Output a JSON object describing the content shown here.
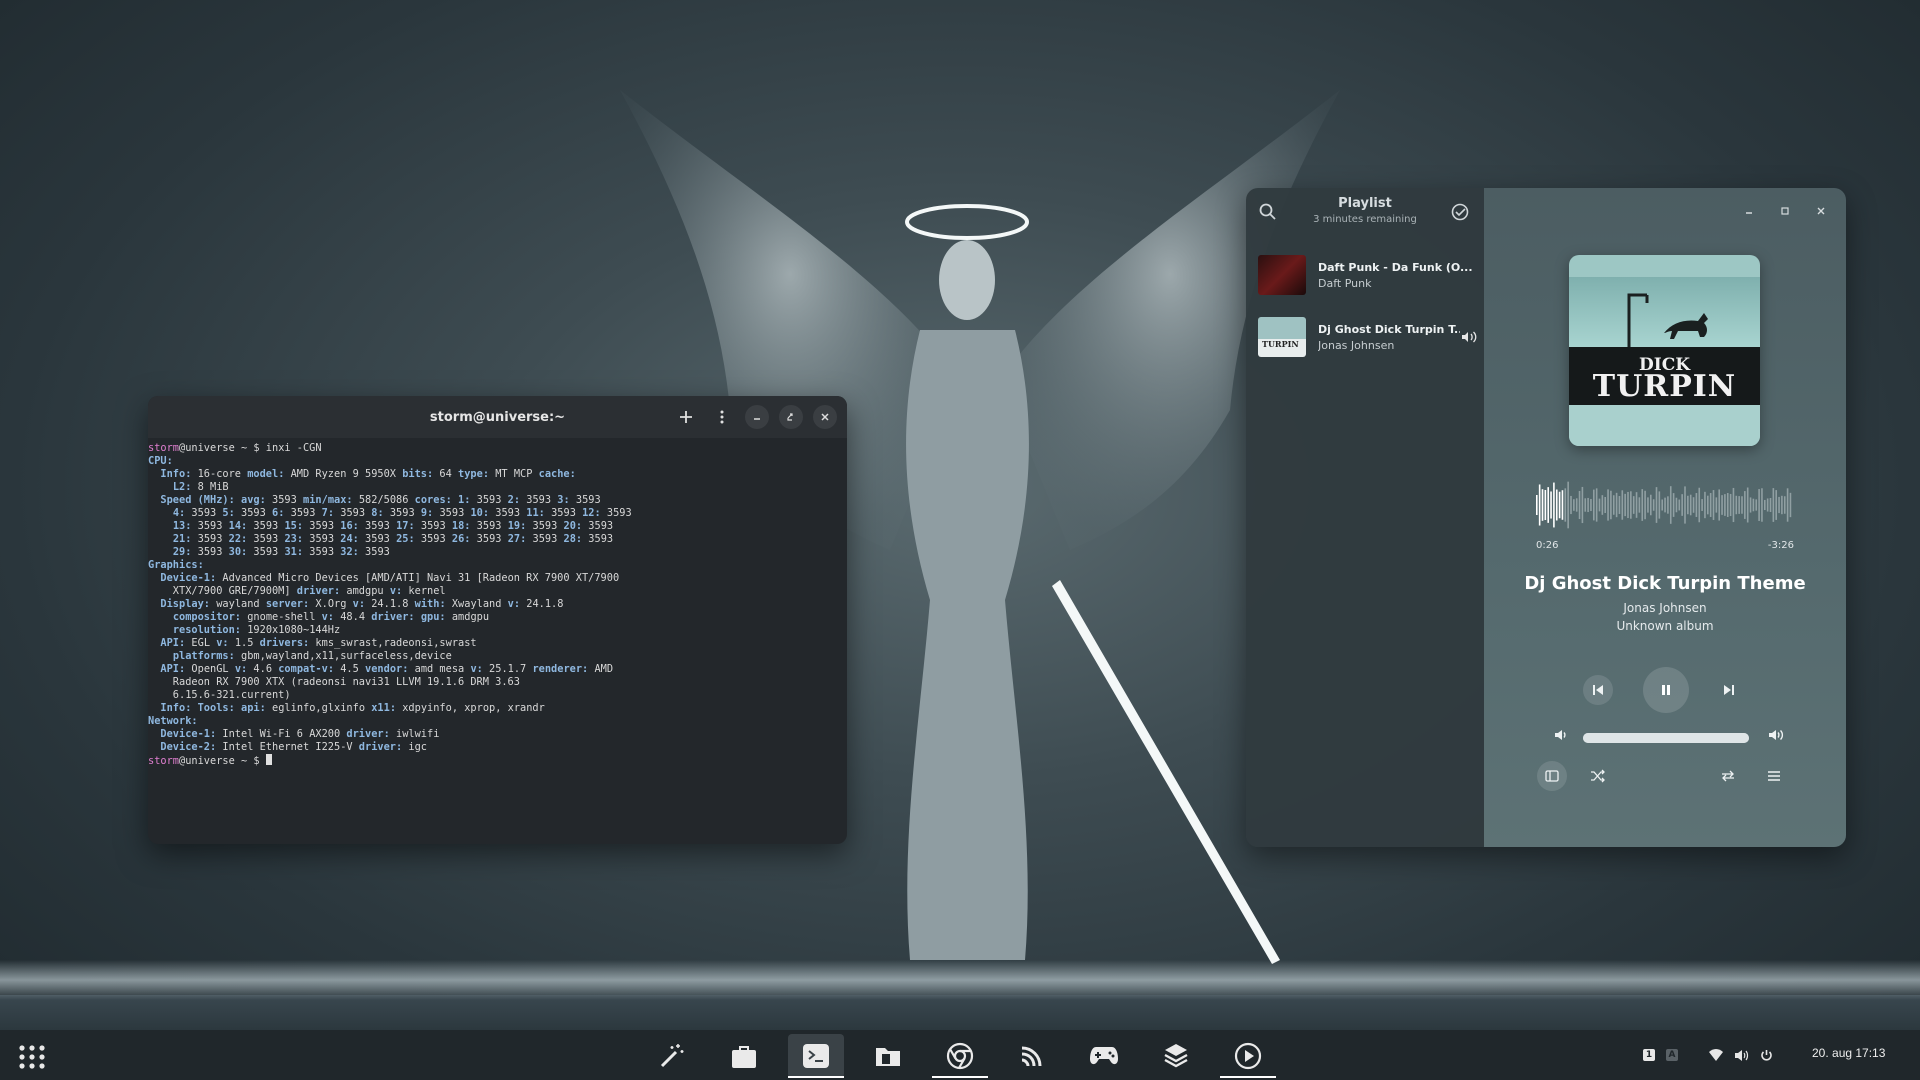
{
  "terminal": {
    "title": "storm@universe:~",
    "lines": [
      [
        [
          "pu",
          "storm"
        ],
        [
          "",
          "@universe ~ $ inxi -CGN"
        ]
      ],
      [
        [
          "sec",
          "CPU:"
        ]
      ],
      [
        [
          "",
          "  "
        ],
        [
          "kw",
          "Info:"
        ],
        [
          "",
          " 16-core "
        ],
        [
          "kw",
          "model:"
        ],
        [
          "",
          " AMD Ryzen 9 5950X "
        ],
        [
          "kw",
          "bits:"
        ],
        [
          "",
          " 64 "
        ],
        [
          "kw",
          "type:"
        ],
        [
          "",
          " MT MCP "
        ],
        [
          "kw",
          "cache:"
        ]
      ],
      [
        [
          "",
          "    "
        ],
        [
          "kw",
          "L2:"
        ],
        [
          "",
          " 8 MiB"
        ]
      ],
      [
        [
          "",
          "  "
        ],
        [
          "kw",
          "Speed (MHz):"
        ],
        [
          "",
          " "
        ],
        [
          "kw",
          "avg:"
        ],
        [
          "",
          " 3593 "
        ],
        [
          "kw",
          "min/max:"
        ],
        [
          "",
          " 582/5086 "
        ],
        [
          "kw",
          "cores:"
        ],
        [
          "",
          " "
        ],
        [
          "kw",
          "1:"
        ],
        [
          "",
          " 3593 "
        ],
        [
          "kw",
          "2:"
        ],
        [
          "",
          " 3593 "
        ],
        [
          "kw",
          "3:"
        ],
        [
          "",
          " 3593"
        ]
      ],
      [
        [
          "",
          "    "
        ],
        [
          "kw",
          "4:"
        ],
        [
          "",
          " 3593 "
        ],
        [
          "kw",
          "5:"
        ],
        [
          "",
          " 3593 "
        ],
        [
          "kw",
          "6:"
        ],
        [
          "",
          " 3593 "
        ],
        [
          "kw",
          "7:"
        ],
        [
          "",
          " 3593 "
        ],
        [
          "kw",
          "8:"
        ],
        [
          "",
          " 3593 "
        ],
        [
          "kw",
          "9:"
        ],
        [
          "",
          " 3593 "
        ],
        [
          "kw",
          "10:"
        ],
        [
          "",
          " 3593 "
        ],
        [
          "kw",
          "11:"
        ],
        [
          "",
          " 3593 "
        ],
        [
          "kw",
          "12:"
        ],
        [
          "",
          " 3593"
        ]
      ],
      [
        [
          "",
          "    "
        ],
        [
          "kw",
          "13:"
        ],
        [
          "",
          " 3593 "
        ],
        [
          "kw",
          "14:"
        ],
        [
          "",
          " 3593 "
        ],
        [
          "kw",
          "15:"
        ],
        [
          "",
          " 3593 "
        ],
        [
          "kw",
          "16:"
        ],
        [
          "",
          " 3593 "
        ],
        [
          "kw",
          "17:"
        ],
        [
          "",
          " 3593 "
        ],
        [
          "kw",
          "18:"
        ],
        [
          "",
          " 3593 "
        ],
        [
          "kw",
          "19:"
        ],
        [
          "",
          " 3593 "
        ],
        [
          "kw",
          "20:"
        ],
        [
          "",
          " 3593"
        ]
      ],
      [
        [
          "",
          "    "
        ],
        [
          "kw",
          "21:"
        ],
        [
          "",
          " 3593 "
        ],
        [
          "kw",
          "22:"
        ],
        [
          "",
          " 3593 "
        ],
        [
          "kw",
          "23:"
        ],
        [
          "",
          " 3593 "
        ],
        [
          "kw",
          "24:"
        ],
        [
          "",
          " 3593 "
        ],
        [
          "kw",
          "25:"
        ],
        [
          "",
          " 3593 "
        ],
        [
          "kw",
          "26:"
        ],
        [
          "",
          " 3593 "
        ],
        [
          "kw",
          "27:"
        ],
        [
          "",
          " 3593 "
        ],
        [
          "kw",
          "28:"
        ],
        [
          "",
          " 3593"
        ]
      ],
      [
        [
          "",
          "    "
        ],
        [
          "kw",
          "29:"
        ],
        [
          "",
          " 3593 "
        ],
        [
          "kw",
          "30:"
        ],
        [
          "",
          " 3593 "
        ],
        [
          "kw",
          "31:"
        ],
        [
          "",
          " 3593 "
        ],
        [
          "kw",
          "32:"
        ],
        [
          "",
          " 3593"
        ]
      ],
      [
        [
          "sec",
          "Graphics:"
        ]
      ],
      [
        [
          "",
          "  "
        ],
        [
          "kw",
          "Device-1:"
        ],
        [
          "",
          " Advanced Micro Devices [AMD/ATI] Navi 31 [Radeon RX 7900 XT/7900"
        ]
      ],
      [
        [
          "",
          "    XTX/7900 GRE/7900M] "
        ],
        [
          "kw",
          "driver:"
        ],
        [
          "",
          " amdgpu "
        ],
        [
          "kw",
          "v:"
        ],
        [
          "",
          " kernel"
        ]
      ],
      [
        [
          "",
          "  "
        ],
        [
          "kw",
          "Display:"
        ],
        [
          "",
          " wayland "
        ],
        [
          "kw",
          "server:"
        ],
        [
          "",
          " X.Org "
        ],
        [
          "kw",
          "v:"
        ],
        [
          "",
          " 24.1.8 "
        ],
        [
          "kw",
          "with:"
        ],
        [
          "",
          " Xwayland "
        ],
        [
          "kw",
          "v:"
        ],
        [
          "",
          " 24.1.8"
        ]
      ],
      [
        [
          "",
          "    "
        ],
        [
          "kw",
          "compositor:"
        ],
        [
          "",
          " gnome-shell "
        ],
        [
          "kw",
          "v:"
        ],
        [
          "",
          " 48.4 "
        ],
        [
          "kw",
          "driver:"
        ],
        [
          "",
          " "
        ],
        [
          "kw",
          "gpu:"
        ],
        [
          "",
          " amdgpu"
        ]
      ],
      [
        [
          "",
          "    "
        ],
        [
          "kw",
          "resolution:"
        ],
        [
          "",
          " 1920x1080~144Hz"
        ]
      ],
      [
        [
          "",
          "  "
        ],
        [
          "kw",
          "API:"
        ],
        [
          "",
          " EGL "
        ],
        [
          "kw",
          "v:"
        ],
        [
          "",
          " 1.5 "
        ],
        [
          "kw",
          "drivers:"
        ],
        [
          "",
          " kms_swrast,radeonsi,swrast"
        ]
      ],
      [
        [
          "",
          "    "
        ],
        [
          "kw",
          "platforms:"
        ],
        [
          "",
          " gbm,wayland,x11,surfaceless,device"
        ]
      ],
      [
        [
          "",
          "  "
        ],
        [
          "kw",
          "API:"
        ],
        [
          "",
          " OpenGL "
        ],
        [
          "kw",
          "v:"
        ],
        [
          "",
          " 4.6 "
        ],
        [
          "kw",
          "compat-v:"
        ],
        [
          "",
          " 4.5 "
        ],
        [
          "kw",
          "vendor:"
        ],
        [
          "",
          " amd mesa "
        ],
        [
          "kw",
          "v:"
        ],
        [
          "",
          " 25.1.7 "
        ],
        [
          "kw",
          "renderer:"
        ],
        [
          "",
          " AMD"
        ]
      ],
      [
        [
          "",
          "    Radeon RX 7900 XTX (radeonsi navi31 LLVM 19.1.6 DRM 3.63"
        ]
      ],
      [
        [
          "",
          "    6.15.6-321.current)"
        ]
      ],
      [
        [
          "",
          "  "
        ],
        [
          "kw",
          "Info:"
        ],
        [
          "",
          " "
        ],
        [
          "kw",
          "Tools:"
        ],
        [
          "",
          " "
        ],
        [
          "kw",
          "api:"
        ],
        [
          "",
          " eglinfo,glxinfo "
        ],
        [
          "kw",
          "x11:"
        ],
        [
          "",
          " xdpyinfo, xprop, xrandr"
        ]
      ],
      [
        [
          "sec",
          "Network:"
        ]
      ],
      [
        [
          "",
          "  "
        ],
        [
          "kw",
          "Device-1:"
        ],
        [
          "",
          " Intel Wi-Fi 6 AX200 "
        ],
        [
          "kw",
          "driver:"
        ],
        [
          "",
          " iwlwifi"
        ]
      ],
      [
        [
          "",
          "  "
        ],
        [
          "kw",
          "Device-2:"
        ],
        [
          "",
          " Intel Ethernet I225-V "
        ],
        [
          "kw",
          "driver:"
        ],
        [
          "",
          " igc"
        ]
      ],
      [
        [
          "pu",
          "storm"
        ],
        [
          "",
          "@universe ~ $ "
        ],
        [
          "cursor",
          ""
        ]
      ]
    ]
  },
  "player": {
    "playlist_title": "Playlist",
    "playlist_sub": "3 minutes remaining",
    "tracks": [
      {
        "name": "Daft Punk - Da Funk (O...",
        "artist": "Daft Punk"
      },
      {
        "name": "Dj Ghost Dick Turpin T...",
        "artist": "Jonas Johnsen"
      }
    ],
    "cover_line1": "DICK",
    "cover_line2": "TURPIN",
    "time_current": "0:26",
    "time_remaining": "-3:26",
    "progress_fraction": 0.11,
    "now_title": "Dj Ghost Dick Turpin Theme",
    "now_artist": "Jonas Johnsen",
    "now_album": "Unknown album",
    "volume_fraction": 1.0
  },
  "dock": {
    "active_app": "terminal-icon"
  },
  "tray": {
    "ws1": "1",
    "ws2": "A",
    "clock": "20. aug  17:13"
  }
}
